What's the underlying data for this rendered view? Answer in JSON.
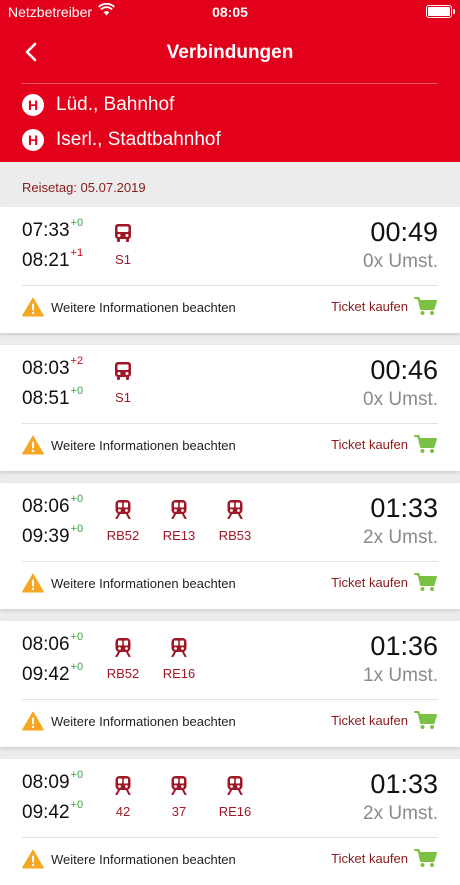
{
  "status_bar": {
    "carrier": "Netzbetreiber",
    "time": "08:05"
  },
  "header": {
    "title": "Verbindungen",
    "from": {
      "icon": "H",
      "name": "Lüd., Bahnhof"
    },
    "to": {
      "icon": "H",
      "name": "Iserl., Stadtbahnhof"
    }
  },
  "travel_date": "Reisetag: 05.07.2019",
  "colors": {
    "brand_red": "#e2001a",
    "train_red": "#a01827",
    "delay_ok": "#2ea836",
    "delay_late": "#d0021b",
    "warning": "#f5a623",
    "cart": "#7ac143"
  },
  "connections": [
    {
      "dep": "07:33",
      "dep_delay": "+0",
      "arr": "08:21",
      "arr_delay": "+1",
      "trains": [
        {
          "icon": "bus-icon",
          "line": "S1"
        }
      ],
      "duration": "00:49",
      "transfers": "0x Umst.",
      "info": "Weitere Informationen beachten",
      "ticket": "Ticket kaufen"
    },
    {
      "dep": "08:03",
      "dep_delay": "+2",
      "arr": "08:51",
      "arr_delay": "+0",
      "trains": [
        {
          "icon": "bus-icon",
          "line": "S1"
        }
      ],
      "duration": "00:46",
      "transfers": "0x Umst.",
      "info": "Weitere Informationen beachten",
      "ticket": "Ticket kaufen"
    },
    {
      "dep": "08:06",
      "dep_delay": "+0",
      "arr": "09:39",
      "arr_delay": "+0",
      "trains": [
        {
          "icon": "train-icon",
          "line": "RB52"
        },
        {
          "icon": "train-icon",
          "line": "RE13"
        },
        {
          "icon": "train-icon",
          "line": "RB53"
        }
      ],
      "duration": "01:33",
      "transfers": "2x Umst.",
      "info": "Weitere Informationen beachten",
      "ticket": "Ticket kaufen"
    },
    {
      "dep": "08:06",
      "dep_delay": "+0",
      "arr": "09:42",
      "arr_delay": "+0",
      "trains": [
        {
          "icon": "train-icon",
          "line": "RB52"
        },
        {
          "icon": "train-icon",
          "line": "RE16"
        }
      ],
      "duration": "01:36",
      "transfers": "1x Umst.",
      "info": "Weitere Informationen beachten",
      "ticket": "Ticket kaufen"
    },
    {
      "dep": "08:09",
      "dep_delay": "+0",
      "arr": "09:42",
      "arr_delay": "+0",
      "trains": [
        {
          "icon": "train-icon",
          "line": "42"
        },
        {
          "icon": "train-icon",
          "line": "37"
        },
        {
          "icon": "train-icon",
          "line": "RE16"
        }
      ],
      "duration": "01:33",
      "transfers": "2x Umst.",
      "info": "Weitere Informationen beachten",
      "ticket": "Ticket kaufen"
    }
  ]
}
